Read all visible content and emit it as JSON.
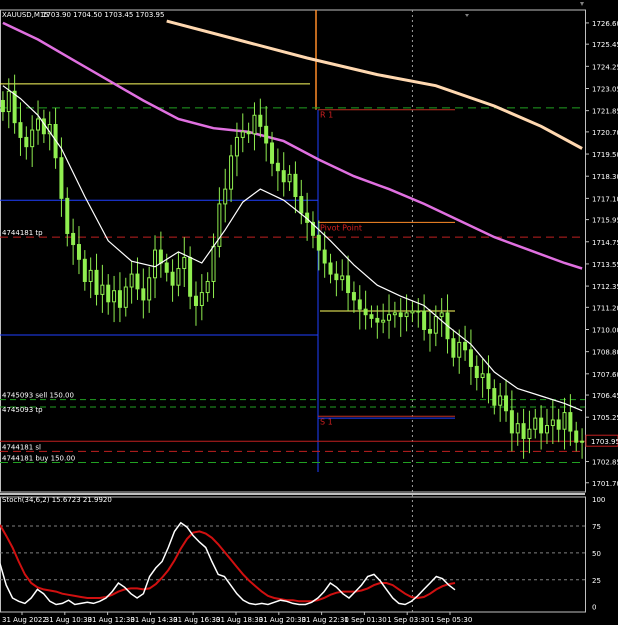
{
  "header": {
    "symbol": "XAUUSD,M15",
    "ohlc": "1703.90 1704.50 1703.45 1703.95"
  },
  "price_box": {
    "text": "1703.95",
    "color": "#ffffff"
  },
  "colors": {
    "bg": "#000000",
    "bull": "#90ee50",
    "bear": "#90ee50",
    "ma_fast": "#ffffff",
    "ma_mid": "#e070e0",
    "ma_slow": "#ffd8b0",
    "pivot": "#ff8c28",
    "res": "#c03020",
    "level_yellow": "#ffff60",
    "level_blue": "#2040ff",
    "level_green": "#22a022",
    "level_red": "#c02020",
    "frame": "#c0c0c0",
    "stoch_main": "#ffffff",
    "stoch_signal": "#d01010"
  },
  "levels_text": {
    "r1": "R 1",
    "pivot": "Pivot Point",
    "s1": "S 1",
    "tp": "4744181 tp",
    "sell1": "4745093 sell 150.00",
    "sell2": "4745093 tp",
    "sl": "4744181 sl",
    "buy": "4744181 buy 150.00"
  },
  "stoch_label": "Stoch(34,6,2) 15.6723 21.9920",
  "chart_data": [
    {
      "type": "candlestick",
      "title": "XAUUSD,M15",
      "y_ticks": [
        "1726.60",
        "1725.45",
        "1724.25",
        "1723.05",
        "1721.85",
        "1720.70",
        "1719.50",
        "1718.30",
        "1717.10",
        "1715.95",
        "1714.75",
        "1713.55",
        "1712.35",
        "1711.20",
        "1710.00",
        "1708.80",
        "1707.60",
        "1706.45",
        "1705.25",
        "1704.05",
        "1702.85",
        "1701.70"
      ],
      "ylim": [
        1701.2,
        1727.3
      ],
      "x_ticks": [
        "31 Aug 2022",
        "31 Aug 10:30",
        "31 Aug 12:30",
        "31 Aug 14:30",
        "31 Aug 16:30",
        "31 Aug 18:30",
        "31 Aug 20:30",
        "31 Aug 22:30",
        "1 Sep 01:30",
        "1 Sep 03:30",
        "1 Sep 05:30"
      ],
      "last_price": 1703.95,
      "close": [
        1721.8,
        1722.9,
        1721.2,
        1720.4,
        1719.9,
        1720.8,
        1721.4,
        1720.6,
        1721.1,
        1719.3,
        1717.1,
        1715.2,
        1714.6,
        1713.8,
        1712.6,
        1713.2,
        1711.9,
        1712.4,
        1711.5,
        1712.1,
        1711.2,
        1712.3,
        1713.0,
        1712.2,
        1711.6,
        1712.8,
        1714.3,
        1713.6,
        1713.1,
        1712.4,
        1713.3,
        1713.9,
        1711.8,
        1711.3,
        1712.0,
        1712.6,
        1714.5,
        1716.8,
        1717.6,
        1719.4,
        1720.4,
        1720.7,
        1720.6,
        1721.6,
        1721.0,
        1720.1,
        1719.0,
        1718.6,
        1718.0,
        1718.4,
        1717.2,
        1716.3,
        1715.8,
        1715.1,
        1714.3,
        1713.6,
        1713.0,
        1712.7,
        1712.9,
        1712.0,
        1711.6,
        1711.1,
        1710.8,
        1710.6,
        1710.4,
        1710.5,
        1710.8,
        1710.9,
        1710.7,
        1710.9,
        1711.0,
        1711.0,
        1710.0,
        1709.8,
        1710.7,
        1710.9,
        1709.5,
        1708.5,
        1709.3,
        1708.9,
        1708.0,
        1707.4,
        1707.6,
        1706.8,
        1705.9,
        1706.4,
        1705.6,
        1704.4,
        1704.9,
        1704.1,
        1704.6,
        1705.2,
        1704.4,
        1704.8,
        1705.1,
        1704.6,
        1705.5,
        1704.5,
        1703.9,
        1703.95
      ],
      "ma": {
        "fast": [
          [
            0,
            1723.2
          ],
          [
            3,
            1722.5
          ],
          [
            6,
            1721.6
          ],
          [
            10,
            1719.8
          ],
          [
            14,
            1717.2
          ],
          [
            18,
            1714.8
          ],
          [
            22,
            1713.7
          ],
          [
            26,
            1713.4
          ],
          [
            30,
            1714.2
          ],
          [
            34,
            1713.6
          ],
          [
            38,
            1715.4
          ],
          [
            41,
            1716.9
          ],
          [
            44,
            1717.6
          ],
          [
            48,
            1717.0
          ],
          [
            52,
            1716.0
          ],
          [
            56,
            1714.8
          ],
          [
            60,
            1713.5
          ],
          [
            64,
            1712.4
          ],
          [
            68,
            1711.8
          ],
          [
            72,
            1711.3
          ],
          [
            76,
            1710.2
          ],
          [
            80,
            1709.2
          ],
          [
            84,
            1707.7
          ],
          [
            88,
            1706.8
          ],
          [
            92,
            1706.4
          ],
          [
            96,
            1706.0
          ],
          [
            99,
            1705.6
          ]
        ],
        "mid": [
          [
            0,
            1726.6
          ],
          [
            6,
            1725.7
          ],
          [
            12,
            1724.6
          ],
          [
            18,
            1723.5
          ],
          [
            24,
            1722.4
          ],
          [
            30,
            1721.4
          ],
          [
            36,
            1720.9
          ],
          [
            42,
            1720.7
          ],
          [
            48,
            1720.2
          ],
          [
            54,
            1719.2
          ],
          [
            60,
            1718.3
          ],
          [
            66,
            1717.6
          ],
          [
            72,
            1716.8
          ],
          [
            78,
            1715.9
          ],
          [
            84,
            1715.0
          ],
          [
            90,
            1714.3
          ],
          [
            96,
            1713.6
          ],
          [
            99,
            1713.3
          ]
        ],
        "slow": [
          [
            28,
            1726.7
          ],
          [
            40,
            1725.7
          ],
          [
            52,
            1724.7
          ],
          [
            64,
            1723.8
          ],
          [
            74,
            1723.2
          ],
          [
            84,
            1722.1
          ],
          [
            92,
            1721.0
          ],
          [
            99,
            1719.8
          ]
        ]
      },
      "levels": {
        "r1": 1721.9,
        "pivot": 1715.8,
        "s1": 1705.3,
        "yellow_upper": 1723.3,
        "yellow_lower": 1711.0,
        "blue_upper": 1717.0,
        "blue_lower": 1709.7,
        "green_dash_upper": 1722.0,
        "green_dash_lower": 1702.8,
        "red_dash_tp": 1715.0,
        "red_dash_sl": 1703.4,
        "sell_lines": [
          1706.2,
          1705.8
        ],
        "blue_s1_mid": 1705.2
      }
    },
    {
      "type": "line",
      "title": "Stoch(34,6,2) 15.6723 21.9920",
      "y_ticks": [
        "100",
        "75",
        "50",
        "25",
        "0"
      ],
      "ylim": [
        -5,
        102
      ],
      "levels": [
        75,
        50,
        25
      ],
      "series": [
        {
          "values": [
            40,
            20,
            8,
            5,
            3,
            8,
            16,
            12,
            5,
            2,
            3,
            6,
            2,
            3,
            4,
            3,
            5,
            8,
            14,
            22,
            18,
            12,
            8,
            12,
            28,
            36,
            42,
            55,
            70,
            78,
            74,
            66,
            60,
            55,
            42,
            30,
            28,
            20,
            12,
            6,
            3,
            2,
            3,
            2,
            4,
            6,
            5,
            3,
            2,
            2,
            4,
            8,
            14,
            22,
            18,
            12,
            8,
            14,
            20,
            28,
            30,
            24,
            16,
            8,
            3,
            2,
            5,
            10,
            16,
            22,
            28,
            26,
            20,
            15.7
          ]
        },
        {
          "values": [
            76,
            66,
            55,
            42,
            30,
            22,
            18,
            16,
            15,
            14,
            12,
            11,
            10,
            9,
            8,
            8,
            8,
            9,
            11,
            14,
            16,
            17,
            17,
            16,
            17,
            21,
            27,
            34,
            43,
            54,
            63,
            69,
            70,
            68,
            64,
            58,
            51,
            44,
            37,
            30,
            24,
            19,
            14,
            10,
            8,
            7,
            6,
            6,
            5,
            5,
            5,
            6,
            8,
            11,
            13,
            14,
            14,
            14,
            15,
            17,
            20,
            22,
            22,
            20,
            16,
            12,
            9,
            8,
            9,
            12,
            16,
            19,
            21,
            21.99
          ]
        }
      ]
    }
  ]
}
